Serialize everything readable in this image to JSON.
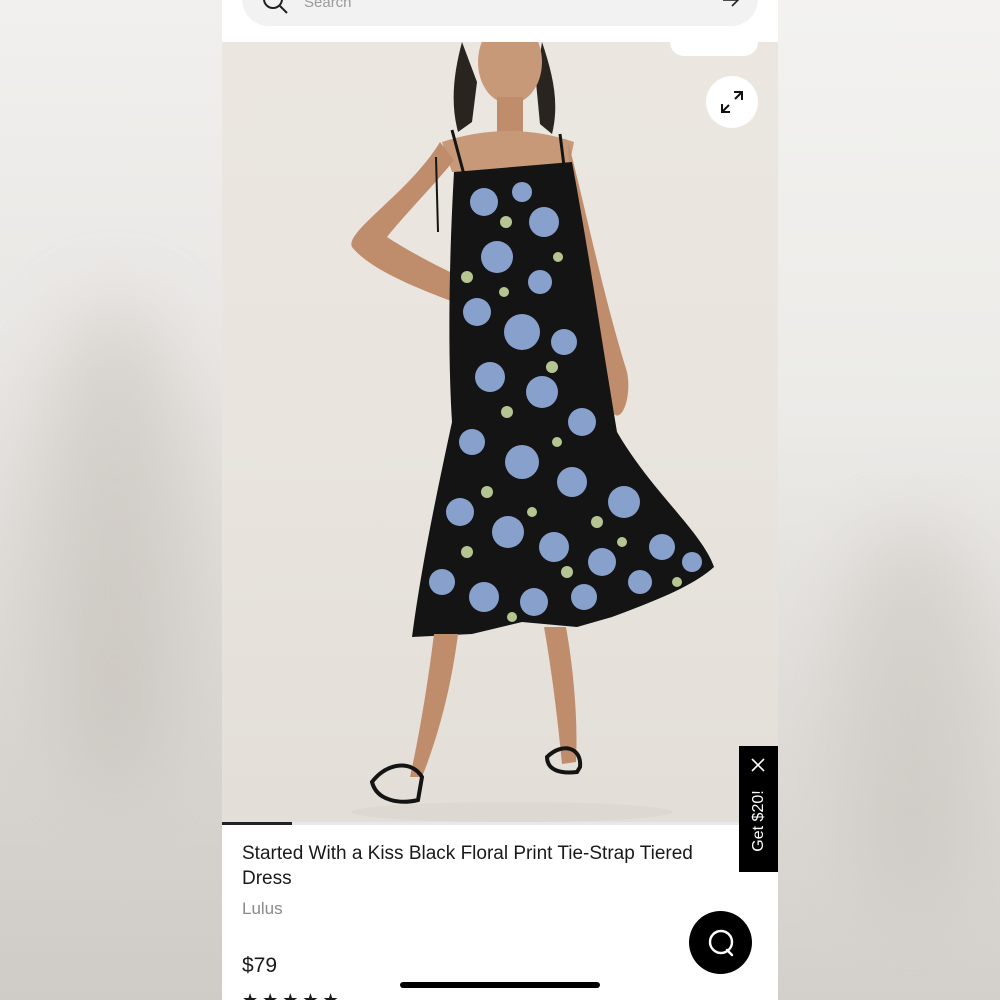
{
  "search": {
    "placeholder": "Search"
  },
  "product": {
    "title": "Started With a Kiss Black Floral Print Tie-Strap Tiered Dress",
    "brand": "Lulus",
    "price": "$79",
    "rating_stars": "★★★★★"
  },
  "image": {
    "carousel_position": 1
  },
  "promo": {
    "label": "Get $20!"
  },
  "icons": {
    "search": "search-icon",
    "arrow": "arrow-right-icon",
    "expand": "expand-icon",
    "close": "close-icon",
    "chat": "chat-icon"
  },
  "colors": {
    "accent": "#000000",
    "dress_blue": "#8fa8d6",
    "dress_black": "#141414"
  }
}
